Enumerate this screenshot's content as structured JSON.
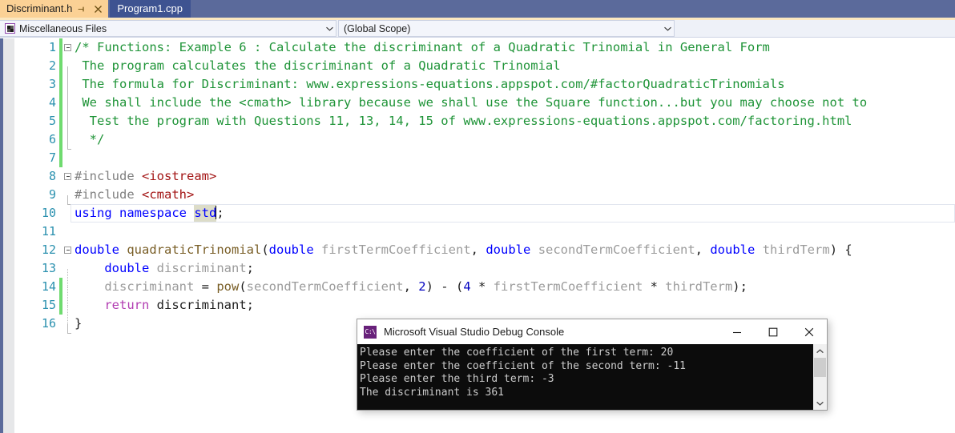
{
  "tabs": [
    {
      "label": "Discriminant.h",
      "active": true,
      "pin_icon": "pin-icon",
      "close_icon": "close-icon"
    },
    {
      "label": "Program1.cpp",
      "active": false
    }
  ],
  "navbar": {
    "project_combo": {
      "value": "Miscellaneous Files",
      "icon": "miscellaneous-files-icon",
      "chevron": "chevron-down-icon"
    },
    "scope_combo": {
      "value": "(Global Scope)",
      "chevron": "chevron-down-icon"
    }
  },
  "editor": {
    "lines": [
      {
        "n": "1",
        "text": "/* Functions: Example 6 : Calculate the discriminant of a Quadratic Trinomial in General Form"
      },
      {
        "n": "2",
        "text": " The program calculates the discriminant of a Quadratic Trinomial"
      },
      {
        "n": "3",
        "text": " The formula for Discriminant: www.expressions-equations.appspot.com/#factorQuadraticTrinomials"
      },
      {
        "n": "4",
        "text": " We shall include the <cmath> library because we shall use the Square function...but you may choose not to"
      },
      {
        "n": "5",
        "text": "  Test the program with Questions 11, 13, 14, 15 of www.expressions-equations.appspot.com/factoring.html"
      },
      {
        "n": "6",
        "text": "  */"
      },
      {
        "n": "7",
        "text": ""
      },
      {
        "n": "8",
        "text": "#include <iostream>"
      },
      {
        "n": "9",
        "text": "#include <cmath>"
      },
      {
        "n": "10",
        "text": "using namespace std;"
      },
      {
        "n": "11",
        "text": ""
      },
      {
        "n": "12",
        "text": "double quadraticTrinomial(double firstTermCoefficient, double secondTermCoefficient, double thirdTerm) {"
      },
      {
        "n": "13",
        "text": "    double discriminant;"
      },
      {
        "n": "14",
        "text": "    discriminant = pow(secondTermCoefficient, 2) - (4 * firstTermCoefficient * thirdTerm);"
      },
      {
        "n": "15",
        "text": "    return discriminant;"
      },
      {
        "n": "16",
        "text": "}"
      }
    ],
    "changed_lines": [
      "1",
      "2",
      "3",
      "4",
      "5",
      "6",
      "7",
      "14",
      "15"
    ],
    "current_line": "10",
    "highlighted_word": "std",
    "tokens": {
      "comment_color": "#1f9438",
      "keyword_color": "#0000ff",
      "preprocessor_color": "#808080",
      "string_color": "#a31515",
      "function_color": "#795e26",
      "variable_color": "#9b9b9b",
      "type_color": "#2b91af",
      "number_color": "#0000c0",
      "control_color": "#b23db2"
    }
  },
  "console": {
    "title": "Microsoft Visual Studio Debug Console",
    "icon": "visual-studio-console-icon",
    "minimize_icon": "minimize-icon",
    "maximize_icon": "maximize-icon",
    "close_icon": "close-icon",
    "output": "Please enter the coefficient of the first term: 20\nPlease enter the coefficient of the second term: -11\nPlease enter the third term: -3\nThe discriminant is 361",
    "lines": [
      "Please enter the coefficient of the first term: 20",
      "Please enter the coefficient of the second term: -11",
      "Please enter the third term: -3",
      "The discriminant is 361"
    ],
    "scroll_up_icon": "chevron-up-icon",
    "scroll_down_icon": "chevron-down-icon",
    "background_color": "#0c0c0c",
    "text_color": "#cccccc"
  }
}
